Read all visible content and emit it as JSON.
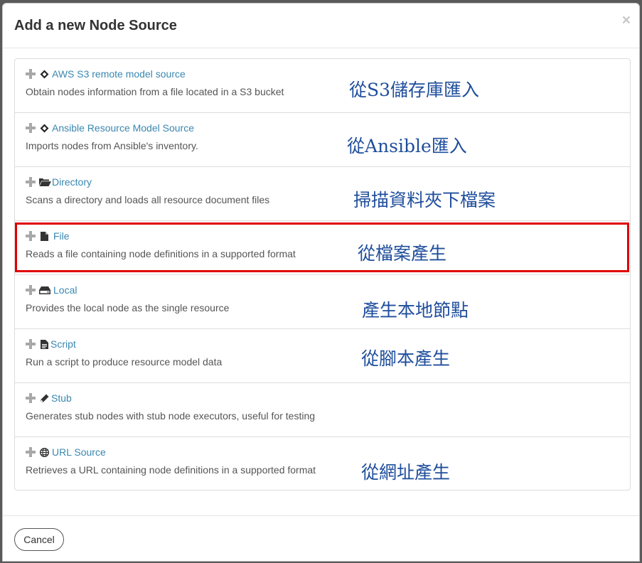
{
  "modal": {
    "title": "Add a new Node Source",
    "close_label": "×",
    "cancel_label": "Cancel"
  },
  "sources": [
    {
      "title": "AWS S3 remote model source",
      "description": "Obtain nodes information from a file located in a S3 bucket",
      "icon": "diamond-icon",
      "note": "從S3儲存庫匯入"
    },
    {
      "title": "Ansible Resource Model Source",
      "description": "Imports nodes from Ansible's inventory.",
      "icon": "diamond-icon",
      "note": "從Ansible匯入"
    },
    {
      "title": "Directory",
      "description": "Scans a directory and loads all resource document files",
      "icon": "folder-open-icon",
      "note": "掃描資料夾下檔案"
    },
    {
      "title": "File",
      "description": "Reads a file containing node definitions in a supported format",
      "icon": "file-icon",
      "note": "從檔案產生",
      "highlighted": true
    },
    {
      "title": "Local",
      "description": "Provides the local node as the single resource",
      "icon": "hdd-icon",
      "note": "產生本地節點"
    },
    {
      "title": "Script",
      "description": "Run a script to produce resource model data",
      "icon": "file-text-icon",
      "note": "從腳本產生"
    },
    {
      "title": "Stub",
      "description": "Generates stub nodes with stub node executors, useful for testing",
      "icon": "pencil-icon",
      "note": ""
    },
    {
      "title": "URL Source",
      "description": "Retrieves a URL containing node definitions in a supported format",
      "icon": "globe-icon",
      "note": "從網址產生"
    }
  ],
  "colors": {
    "link": "#3a87b0",
    "annotation": "#1f4e9c",
    "highlight_border": "#e00000"
  }
}
